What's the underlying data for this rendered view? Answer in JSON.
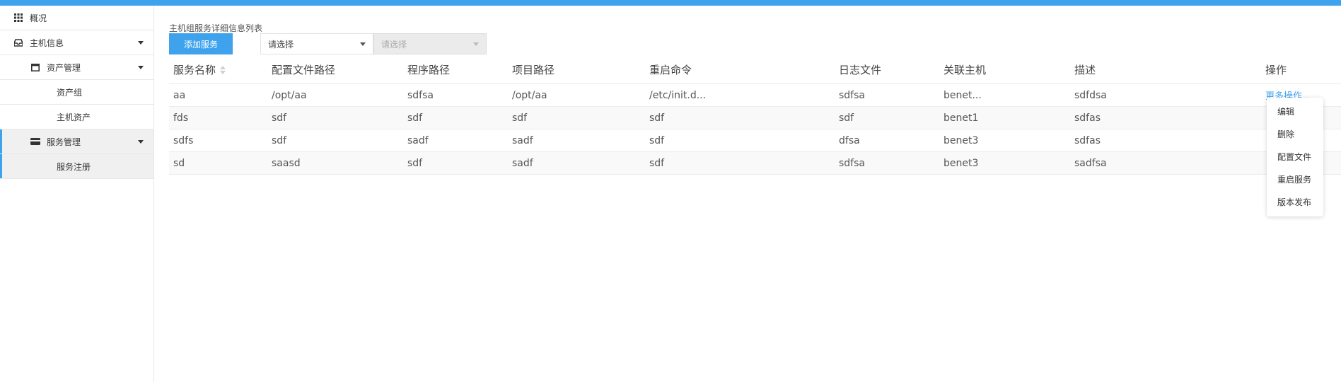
{
  "sidebar": {
    "items": [
      {
        "label": "概况"
      },
      {
        "label": "主机信息"
      },
      {
        "label": "资产管理"
      },
      {
        "label": "资产组"
      },
      {
        "label": "主机资产"
      },
      {
        "label": "服务管理"
      },
      {
        "label": "服务注册"
      }
    ]
  },
  "main": {
    "section_title": "主机组服务详细信息列表",
    "add_button": "添加服务",
    "select1_placeholder": "请选择",
    "select2_placeholder": "请选择"
  },
  "table": {
    "headers": [
      "服务名称",
      "配置文件路径",
      "程序路径",
      "项目路径",
      "重启命令",
      "日志文件",
      "关联主机",
      "描述",
      "操作"
    ],
    "rows": [
      [
        "aa",
        "/opt/aa",
        "sdfsa",
        "/opt/aa",
        "/etc/init.d...",
        "sdfsa",
        "benet...",
        "sdfdsa"
      ],
      [
        "fds",
        "sdf",
        "sdf",
        "sdf",
        "sdf",
        "sdf",
        "benet1",
        "sdfas"
      ],
      [
        "sdfs",
        "sdf",
        "sadf",
        "sadf",
        "sdf",
        "dfsa",
        "benet3",
        "sdfas"
      ],
      [
        "sd",
        "saasd",
        "sdf",
        "sadf",
        "sdf",
        "sdfsa",
        "benet3",
        "sadfsa"
      ]
    ],
    "more_label": "更多操作",
    "dropdown_items": [
      "编辑",
      "删除",
      "配置文件",
      "重启服务",
      "版本发布"
    ]
  },
  "colors": {
    "accent": "#3ea2ec",
    "sidebar_active_bg": "#f0f0f0"
  }
}
